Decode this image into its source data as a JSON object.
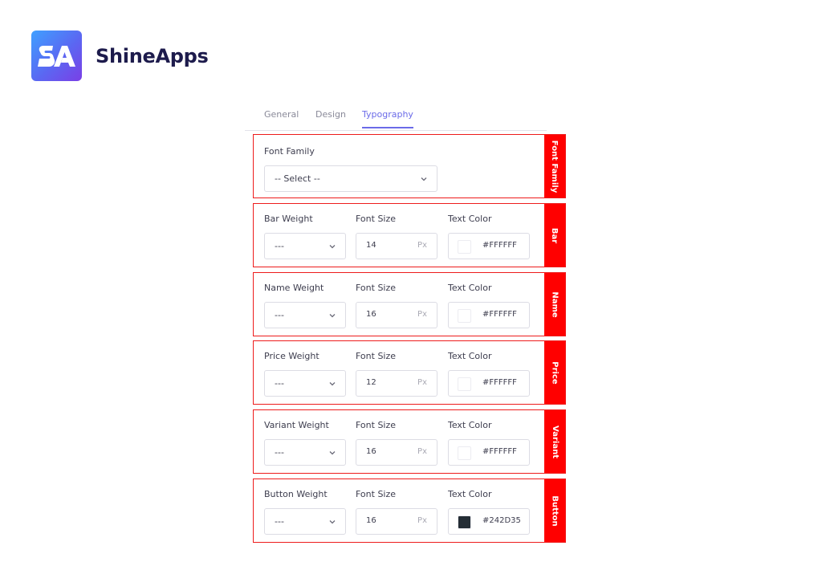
{
  "brand": {
    "logo_letters": "SA",
    "name": "ShineApps",
    "logo_gradient": [
      "#3fa0ff",
      "#7a3fe6"
    ]
  },
  "tabs": [
    {
      "label": "General",
      "active": false
    },
    {
      "label": "Design",
      "active": false
    },
    {
      "label": "Typography",
      "active": true
    }
  ],
  "font_family_section": {
    "side_label": "Font Family",
    "field_label": "Font Family",
    "select_value": "-- Select --"
  },
  "rows": [
    {
      "side_label": "Bar",
      "weight_label": "Bar Weight",
      "weight_value": "---",
      "size_label": "Font Size",
      "size_value": "14",
      "unit": "Px",
      "color_label": "Text Color",
      "color_hex": "#FFFFFF",
      "swatch": "#ffffff"
    },
    {
      "side_label": "Name",
      "weight_label": "Name Weight",
      "weight_value": "---",
      "size_label": "Font Size",
      "size_value": "16",
      "unit": "Px",
      "color_label": "Text Color",
      "color_hex": "#FFFFFF",
      "swatch": "#ffffff"
    },
    {
      "side_label": "Price",
      "weight_label": "Price Weight",
      "weight_value": "---",
      "size_label": "Font Size",
      "size_value": "12",
      "unit": "Px",
      "color_label": "Text Color",
      "color_hex": "#FFFFFF",
      "swatch": "#ffffff"
    },
    {
      "side_label": "Variant",
      "weight_label": "Variant Weight",
      "weight_value": "---",
      "size_label": "Font Size",
      "size_value": "16",
      "unit": "Px",
      "color_label": "Text Color",
      "color_hex": "#FFFFFF",
      "swatch": "#ffffff"
    },
    {
      "side_label": "Button",
      "weight_label": "Button Weight",
      "weight_value": "---",
      "size_label": "Font Size",
      "size_value": "16",
      "unit": "Px",
      "color_label": "Text Color",
      "color_hex": "#242D35",
      "swatch": "#242d35"
    }
  ],
  "colors": {
    "accent": "#6b6be8",
    "section_border": "#ee1c1c",
    "side_label_bg": "#ff0000"
  }
}
